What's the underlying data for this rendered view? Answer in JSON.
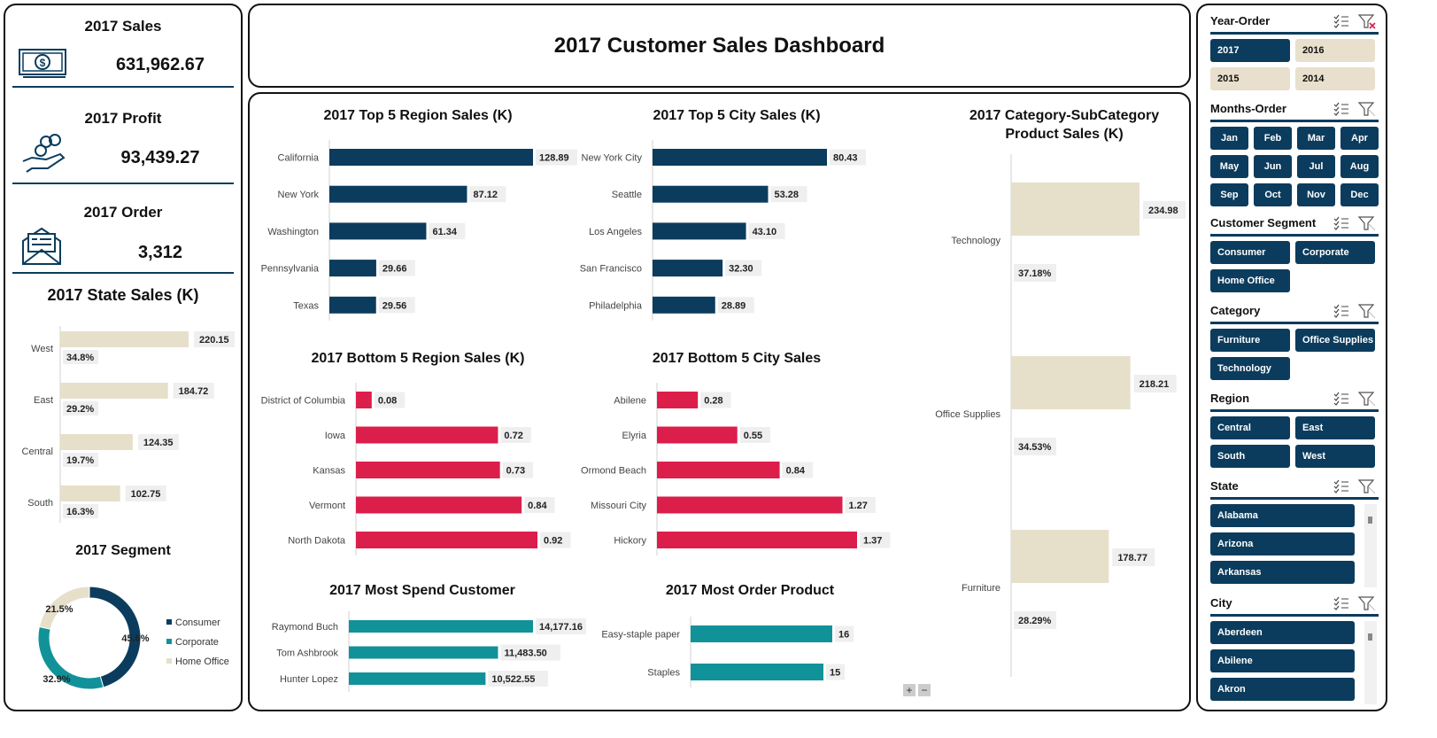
{
  "kpis": {
    "sales_title": "2017 Sales",
    "sales_value": "631,962.67",
    "profit_title": "2017 Profit",
    "profit_value": "93,439.27",
    "order_title": "2017 Order",
    "order_value": "3,312"
  },
  "header": {
    "title": "2017 Customer Sales Dashboard"
  },
  "colors": {
    "navy": "#0b3c5d",
    "red": "#dc1e4b",
    "teal": "#119299",
    "beige": "#e6dfca"
  },
  "icons": [
    "money-bill-icon",
    "hand-coins-icon",
    "envelope-icon",
    "checklist-icon",
    "clear-filter-icon",
    "zoom-in-icon",
    "zoom-out-icon"
  ],
  "chart_data": [
    {
      "id": "state",
      "type": "bar",
      "title": "2017 State Sales (K)",
      "categories": [
        "West",
        "East",
        "Central",
        "South"
      ],
      "values": [
        220.15,
        184.72,
        124.35,
        102.75
      ],
      "value_labels": [
        "220.15",
        "184.72",
        "124.35",
        "102.75"
      ],
      "percents": [
        "34.8%",
        "29.2%",
        "19.7%",
        "16.3%"
      ],
      "color": "#e6dfca"
    },
    {
      "id": "segment",
      "type": "pie",
      "title": "2017 Segment",
      "categories": [
        "Consumer",
        "Corporate",
        "Home Office"
      ],
      "values": [
        45.6,
        32.9,
        21.5
      ],
      "value_labels": [
        "45.6%",
        "32.9%",
        "21.5%"
      ],
      "colors": [
        "#0b3c5d",
        "#119299",
        "#e6dfca"
      ],
      "legend": "right"
    },
    {
      "id": "top_region",
      "type": "bar",
      "title": "2017 Top 5 Region Sales (K)",
      "categories": [
        "California",
        "New York",
        "Washington",
        "Pennsylvania",
        "Texas"
      ],
      "values": [
        128.89,
        87.12,
        61.34,
        29.66,
        29.56
      ],
      "value_labels": [
        "128.89",
        "87.12",
        "61.34",
        "29.66",
        "29.56"
      ],
      "color": "#0b3c5d"
    },
    {
      "id": "top_city",
      "type": "bar",
      "title": "2017 Top 5 City Sales (K)",
      "categories": [
        "New York City",
        "Seattle",
        "Los Angeles",
        "San Francisco",
        "Philadelphia"
      ],
      "values": [
        80.43,
        53.28,
        43.1,
        32.3,
        28.89
      ],
      "value_labels": [
        "80.43",
        "53.28",
        "43.10",
        "32.30",
        "28.89"
      ],
      "color": "#0b3c5d"
    },
    {
      "id": "bottom_region",
      "type": "bar",
      "title": "2017 Bottom 5 Region Sales (K)",
      "categories": [
        "District of Columbia",
        "Iowa",
        "Kansas",
        "Vermont",
        "North Dakota"
      ],
      "values": [
        0.08,
        0.72,
        0.73,
        0.84,
        0.92
      ],
      "value_labels": [
        "0.08",
        "0.72",
        "0.73",
        "0.84",
        "0.92"
      ],
      "color": "#dc1e4b"
    },
    {
      "id": "bottom_city",
      "type": "bar",
      "title": "2017 Bottom 5 City Sales",
      "categories": [
        "Abilene",
        "Elyria",
        "Ormond Beach",
        "Missouri City",
        "Hickory"
      ],
      "values": [
        0.28,
        0.55,
        0.84,
        1.27,
        1.37
      ],
      "value_labels": [
        "0.28",
        "0.55",
        "0.84",
        "1.27",
        "1.37"
      ],
      "color": "#dc1e4b"
    },
    {
      "id": "customer",
      "type": "bar",
      "title": "2017 Most Spend Customer",
      "categories": [
        "Raymond Buch",
        "Tom Ashbrook",
        "Hunter Lopez"
      ],
      "values": [
        14177.16,
        11483.5,
        10522.55
      ],
      "value_labels": [
        "14,177.16",
        "11,483.50",
        "10,522.55"
      ],
      "color": "#119299"
    },
    {
      "id": "product",
      "type": "bar",
      "title": "2017 Most Order Product",
      "categories": [
        "Easy-staple paper",
        "Staples"
      ],
      "values": [
        16,
        15
      ],
      "value_labels": [
        "16",
        "15"
      ],
      "color": "#119299"
    },
    {
      "id": "category",
      "type": "bar",
      "title": "2017 Category-SubCategory Product Sales (K)",
      "categories": [
        "Technology",
        "Office Supplies",
        "Furniture"
      ],
      "values": [
        234.98,
        218.21,
        178.77
      ],
      "value_labels": [
        "234.98",
        "218.21",
        "178.77"
      ],
      "percents": [
        "37.18%",
        "34.53%",
        "28.29%"
      ],
      "color": "#e6dfca"
    }
  ],
  "slicers": [
    {
      "title": "Year-Order",
      "layout": "w2",
      "items": [
        {
          "label": "2017",
          "selected": true
        },
        {
          "label": "2016",
          "selected": false
        },
        {
          "label": "2015",
          "selected": false
        },
        {
          "label": "2014",
          "selected": false
        }
      ]
    },
    {
      "title": "Months-Order",
      "layout": "w4",
      "items": [
        {
          "label": "Jan",
          "selected": true
        },
        {
          "label": "Feb",
          "selected": true
        },
        {
          "label": "Mar",
          "selected": true
        },
        {
          "label": "Apr",
          "selected": true
        },
        {
          "label": "May",
          "selected": true
        },
        {
          "label": "Jun",
          "selected": true
        },
        {
          "label": "Jul",
          "selected": true
        },
        {
          "label": "Aug",
          "selected": true
        },
        {
          "label": "Sep",
          "selected": true
        },
        {
          "label": "Oct",
          "selected": true
        },
        {
          "label": "Nov",
          "selected": true
        },
        {
          "label": "Dec",
          "selected": true
        }
      ]
    },
    {
      "title": "Customer Segment",
      "layout": "w2",
      "items": [
        {
          "label": "Consumer",
          "selected": true
        },
        {
          "label": "Corporate",
          "selected": true
        },
        {
          "label": "Home Office",
          "selected": true
        }
      ]
    },
    {
      "title": "Category",
      "layout": "w2",
      "items": [
        {
          "label": "Furniture",
          "selected": true
        },
        {
          "label": "Office Supplies",
          "selected": true
        },
        {
          "label": "Technology",
          "selected": true
        }
      ]
    },
    {
      "title": "Region",
      "layout": "w2",
      "items": [
        {
          "label": "Central",
          "selected": true
        },
        {
          "label": "East",
          "selected": true
        },
        {
          "label": "South",
          "selected": true
        },
        {
          "label": "West",
          "selected": true
        }
      ]
    },
    {
      "title": "State",
      "layout": "wl",
      "scroll": true,
      "items": [
        {
          "label": "Alabama",
          "selected": true
        },
        {
          "label": "Arizona",
          "selected": true
        },
        {
          "label": "Arkansas",
          "selected": true
        }
      ]
    },
    {
      "title": "City",
      "layout": "wl",
      "scroll": true,
      "items": [
        {
          "label": "Aberdeen",
          "selected": true
        },
        {
          "label": "Abilene",
          "selected": true
        },
        {
          "label": "Akron",
          "selected": true
        }
      ]
    }
  ],
  "zoom": {
    "plus": "+",
    "minus": "−"
  }
}
